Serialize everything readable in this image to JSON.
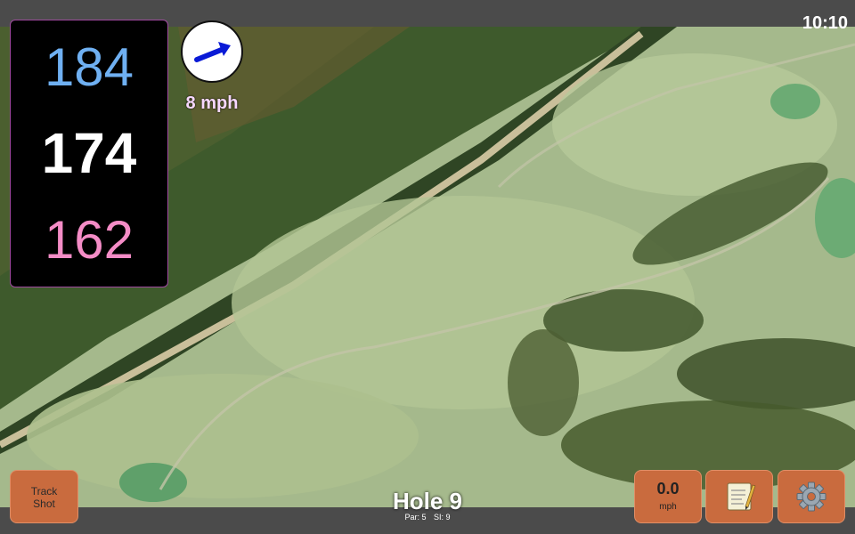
{
  "clock": "10:10",
  "distances": {
    "back": "184",
    "middle": "174",
    "front": "162"
  },
  "wind": {
    "speed_label": "8 mph"
  },
  "buttons": {
    "track_shot_line1": "Track",
    "track_shot_line2": "Shot"
  },
  "speed": {
    "value": "0.0",
    "unit": "mph"
  },
  "hole": {
    "title": "Hole 9",
    "par": "Par: 5",
    "si": "SI: 9"
  },
  "icons": {
    "notes": "notepad-icon",
    "settings": "gear-icon",
    "wind": "wind-arrow-icon"
  },
  "colors": {
    "back": "#6fb0f2",
    "middle": "#ffffff",
    "front": "#f48cc6",
    "button": "#c96b3e"
  }
}
